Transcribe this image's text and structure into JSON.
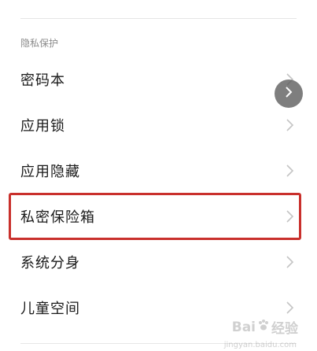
{
  "section": {
    "header": "隐私保护"
  },
  "items": [
    {
      "label": "密码本"
    },
    {
      "label": "应用锁"
    },
    {
      "label": "应用隐藏"
    },
    {
      "label": "私密保险箱"
    },
    {
      "label": "系统分身"
    },
    {
      "label": "儿童空间"
    }
  ],
  "highlight": {
    "color": "#c9302c",
    "item_index": 3
  },
  "float_button": {
    "icon": "chevron-right-icon"
  },
  "watermark": {
    "text_left": "Bai",
    "text_right": "经验",
    "sub": "jingyan.baidu.com"
  }
}
